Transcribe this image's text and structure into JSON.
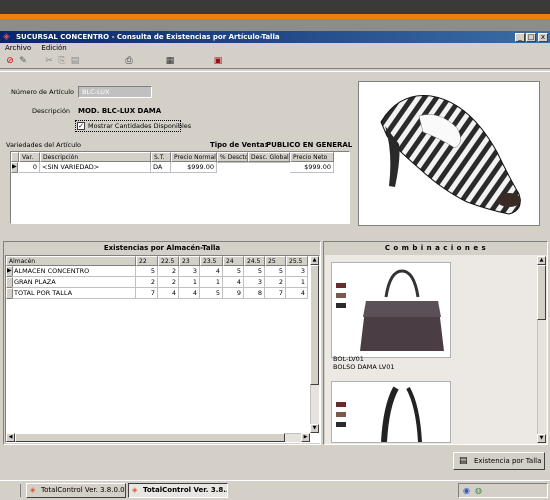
{
  "window": {
    "title": "SUCURSAL CONCENTRO - Consulta de Existencias por Artículo-Talla",
    "min_glyph": "_",
    "max_glyph": "□",
    "close_glyph": "x"
  },
  "menu": [
    "Archivo",
    "Edición"
  ],
  "form": {
    "article_number_label": "Número de Artículo",
    "article_number_value": "BLC-LUX",
    "description_label": "Descripción",
    "description_value": "MOD. BLC-LUX DAMA",
    "show_qty_label": "Mostrar Cantidades Disponibles",
    "show_qty_checked": true,
    "varieties_label": "Variedades del Artículo",
    "sale_type_label": "Tipo de Venta:",
    "sale_type_value": "PUBLICO EN GENERAL"
  },
  "varieties_table": {
    "headers": [
      "Var.",
      "Descripción",
      "S.T.",
      "Precio Normal",
      "% Descto.",
      "Desc. Global",
      "Precio Neto"
    ],
    "rows": [
      [
        "0",
        "<SIN VARIEDAD>",
        "DA",
        "$999.00",
        "",
        "",
        "$999.00"
      ]
    ]
  },
  "existences": {
    "title": "Existencias por Almacén-Talla",
    "headers": [
      "Almacén",
      "22",
      "22.5",
      "23",
      "23.5",
      "24",
      "24.5",
      "25",
      "25.5"
    ],
    "rows": [
      [
        "ALMACEN CONCENTRO",
        "5",
        "2",
        "3",
        "4",
        "5",
        "5",
        "5",
        "3"
      ],
      [
        "GRAN PLAZA",
        "2",
        "2",
        "1",
        "1",
        "4",
        "3",
        "2",
        "1"
      ],
      [
        "TOTAL POR TALLA",
        "7",
        "4",
        "4",
        "5",
        "9",
        "8",
        "7",
        "4"
      ]
    ]
  },
  "combinations": {
    "title": "C o m b i n a c i o n e s",
    "items": [
      {
        "code": "BOL-LV01",
        "name": "BOLSO DAMA LV01"
      }
    ]
  },
  "buttons": {
    "existencia_talla": "Existencia por Talla"
  },
  "taskbar": {
    "items": [
      "TotalControl Ver. 3.8.0.0",
      "TotalControl Ver. 3.8..."
    ]
  },
  "icons": {
    "app": "diamond-app-icon",
    "no": "no-entry-icon",
    "save": "save-icon"
  },
  "colors": {
    "titlebar": "#0a246a",
    "accent": "#e8830f"
  }
}
